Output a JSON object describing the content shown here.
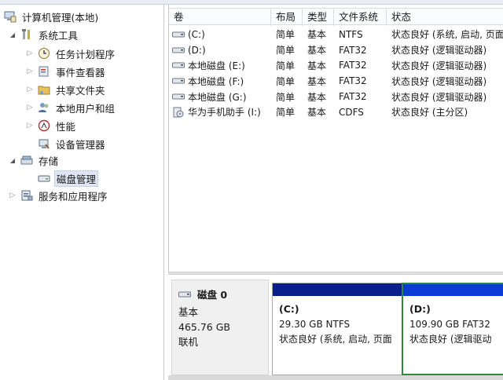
{
  "tree": {
    "root": "计算机管理(本地)",
    "system_tools": "系统工具",
    "task_scheduler": "任务计划程序",
    "event_viewer": "事件查看器",
    "shared_folders": "共享文件夹",
    "local_users": "本地用户和组",
    "performance": "性能",
    "device_manager": "设备管理器",
    "storage": "存储",
    "disk_management": "磁盘管理",
    "services_apps": "服务和应用程序"
  },
  "list": {
    "headers": {
      "volume": "卷",
      "layout": "布局",
      "type": "类型",
      "fs": "文件系统",
      "status": "状态"
    },
    "rows": [
      {
        "volume": "(C:)",
        "layout": "简单",
        "type": "基本",
        "fs": "NTFS",
        "status": "状态良好 (系统, 启动, 页面"
      },
      {
        "volume": "(D:)",
        "layout": "简单",
        "type": "基本",
        "fs": "FAT32",
        "status": "状态良好 (逻辑驱动器)"
      },
      {
        "volume": "本地磁盘 (E:)",
        "layout": "简单",
        "type": "基本",
        "fs": "FAT32",
        "status": "状态良好 (逻辑驱动器)"
      },
      {
        "volume": "本地磁盘 (F:)",
        "layout": "简单",
        "type": "基本",
        "fs": "FAT32",
        "status": "状态良好 (逻辑驱动器)"
      },
      {
        "volume": "本地磁盘 (G:)",
        "layout": "简单",
        "type": "基本",
        "fs": "FAT32",
        "status": "状态良好 (逻辑驱动器)"
      },
      {
        "volume": "华为手机助手 (I:)",
        "layout": "简单",
        "type": "基本",
        "fs": "CDFS",
        "status": "状态良好 (主分区)"
      }
    ]
  },
  "disk0": {
    "name": "磁盘 0",
    "kind": "基本",
    "size": "465.76 GB",
    "state": "联机",
    "partitions": [
      {
        "name": "(C:)",
        "info": "29.30 GB NTFS",
        "status": "状态良好 (系统, 启动, 页面"
      },
      {
        "name": "(D:)",
        "info": "109.90 GB FAT32",
        "status": "状态良好 (逻辑驱动"
      }
    ]
  },
  "colors": {
    "primary_band": "#0a1f8a",
    "logical_band": "#0b3dd6",
    "selected_border": "#2f8a3a"
  }
}
